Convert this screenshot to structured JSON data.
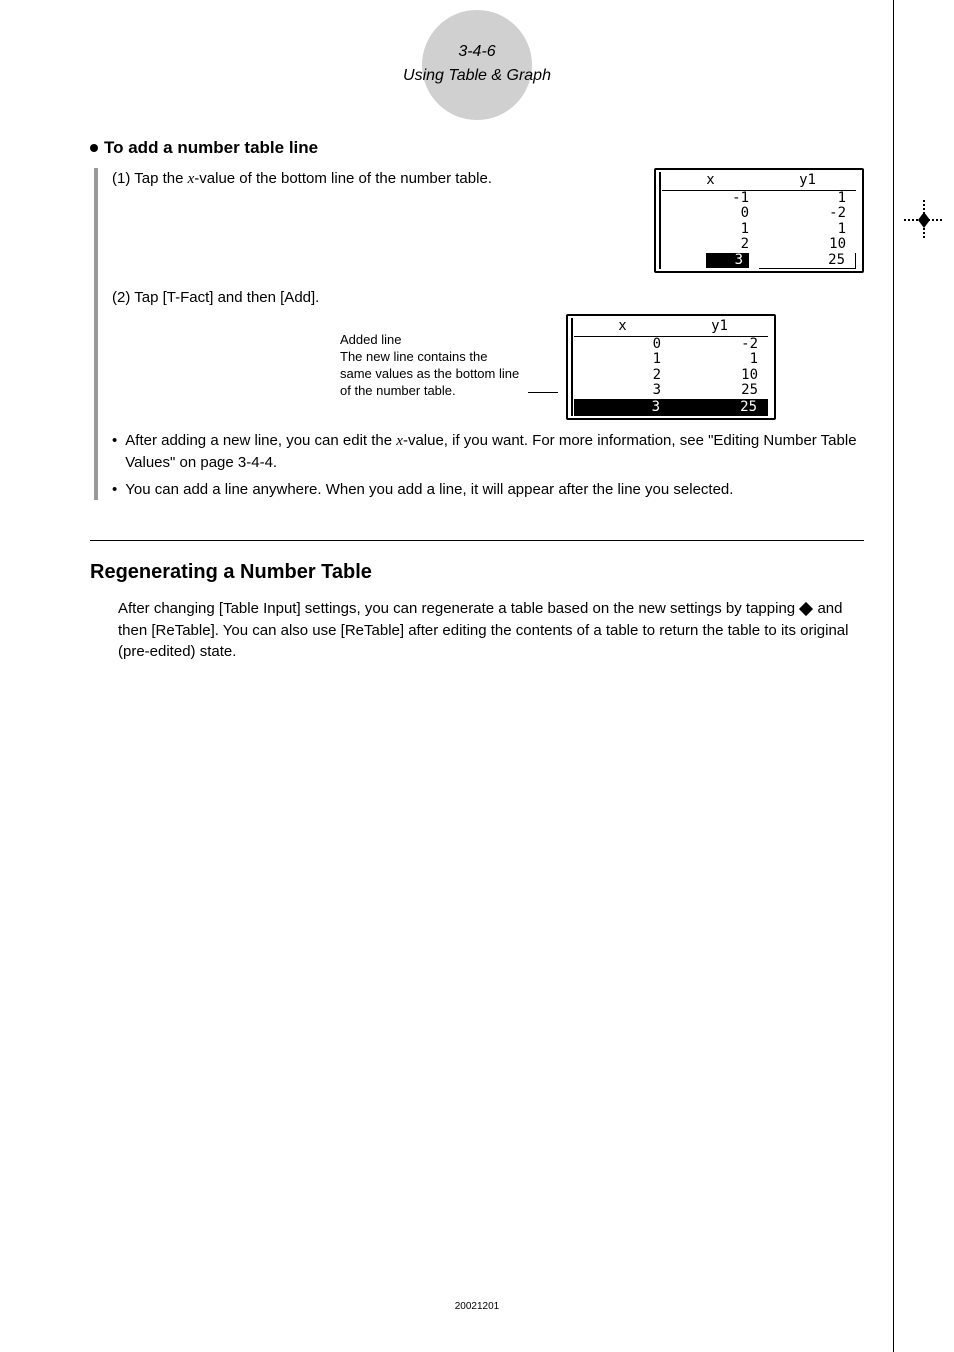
{
  "header": {
    "section_number": "3-4-6",
    "section_title": "Using Table & Graph"
  },
  "heading": "To add a number table line",
  "step1": {
    "label": "(1) Tap the ",
    "var": "x",
    "label_end": "-value of the bottom line of the number table."
  },
  "table1": {
    "head_x": "x",
    "head_y": "y1",
    "rows": [
      {
        "x": "-1",
        "y": "1"
      },
      {
        "x": "0",
        "y": "-2"
      },
      {
        "x": "1",
        "y": "1"
      },
      {
        "x": "2",
        "y": "10"
      },
      {
        "x": "3",
        "y": "25"
      }
    ],
    "highlighted_row_index": 4,
    "highlight_col": "x"
  },
  "step2": {
    "label": "(2) Tap [T-Fact] and then [Add]."
  },
  "annotation": {
    "title": "Added line",
    "body": "The new line contains the same values as the bottom line of the number table."
  },
  "table2": {
    "head_x": "x",
    "head_y": "y1",
    "rows": [
      {
        "x": "0",
        "y": "-2"
      },
      {
        "x": "1",
        "y": "1"
      },
      {
        "x": "2",
        "y": "10"
      },
      {
        "x": "3",
        "y": "25"
      },
      {
        "x": "3",
        "y": "25"
      }
    ],
    "highlighted_row_index": 4
  },
  "notes": [
    "After adding a new line, you can edit the x-value, if you want. For more information, see \"Editing Number Table Values\" on page 3-4-4.",
    "You can add a line anywhere. When you add a line, it will appear after the line you selected."
  ],
  "section2": {
    "title": "Regenerating a Number Table",
    "body_a": "After changing [Table Input] settings, you can regenerate a table based on the new settings by tapping ",
    "body_b": " and then [ReTable]. You can also use [ReTable] after editing the contents of a table to return the table to its original (pre-edited) state."
  },
  "footer": "20021201",
  "chart_data": [
    {
      "type": "table",
      "title": "Number table before add",
      "columns": [
        "x",
        "y1"
      ],
      "data": [
        [
          -1,
          1
        ],
        [
          0,
          -2
        ],
        [
          1,
          1
        ],
        [
          2,
          10
        ],
        [
          3,
          25
        ]
      ],
      "selected_row": 4
    },
    {
      "type": "table",
      "title": "Number table after add",
      "columns": [
        "x",
        "y1"
      ],
      "data": [
        [
          0,
          -2
        ],
        [
          1,
          1
        ],
        [
          2,
          10
        ],
        [
          3,
          25
        ],
        [
          3,
          25
        ]
      ],
      "selected_row": 4
    }
  ]
}
